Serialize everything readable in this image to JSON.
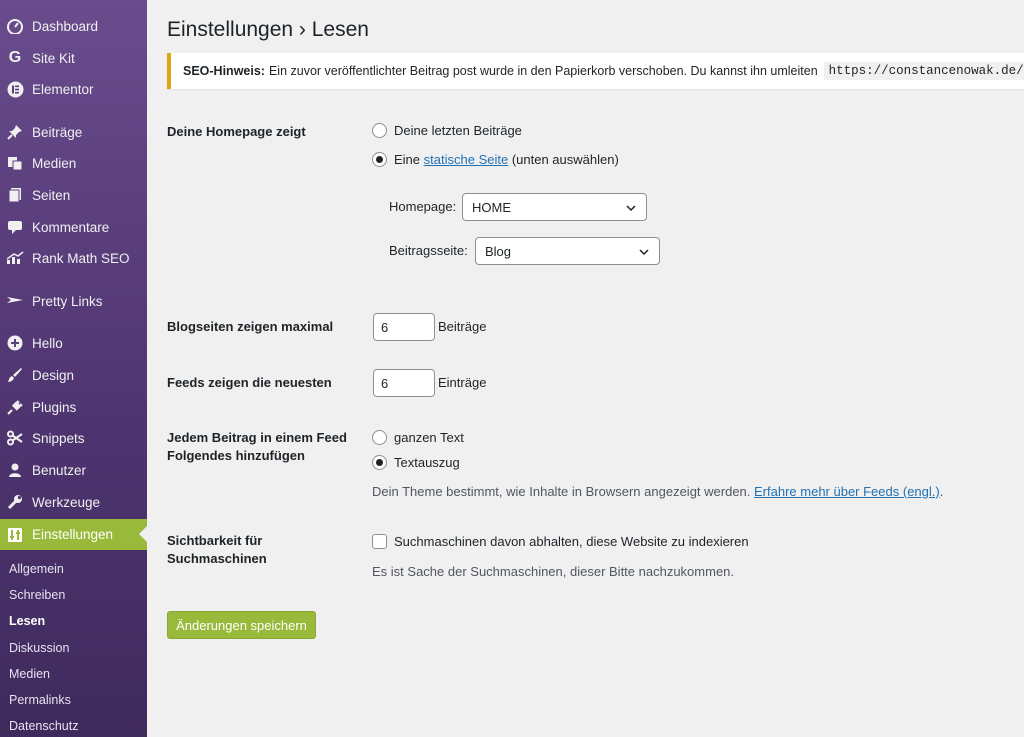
{
  "sidebar": {
    "items": [
      {
        "label": "Dashboard",
        "icon": "dashboard-icon"
      },
      {
        "label": "Site Kit",
        "icon": "google-g-icon"
      },
      {
        "label": "Elementor",
        "icon": "elementor-icon"
      },
      {
        "label": "Beiträge",
        "icon": "pin-icon"
      },
      {
        "label": "Medien",
        "icon": "media-icon"
      },
      {
        "label": "Seiten",
        "icon": "pages-icon"
      },
      {
        "label": "Kommentare",
        "icon": "comment-icon"
      },
      {
        "label": "Rank Math SEO",
        "icon": "rank-math-icon"
      },
      {
        "label": "Pretty Links",
        "icon": "pretty-links-icon"
      },
      {
        "label": "Hello",
        "icon": "plus-circle-icon"
      },
      {
        "label": "Design",
        "icon": "brush-icon"
      },
      {
        "label": "Plugins",
        "icon": "plug-icon"
      },
      {
        "label": "Snippets",
        "icon": "scissors-icon"
      },
      {
        "label": "Benutzer",
        "icon": "user-icon"
      },
      {
        "label": "Werkzeuge",
        "icon": "wrench-icon"
      },
      {
        "label": "Einstellungen",
        "icon": "settings-icon",
        "active": true
      }
    ],
    "submenu": [
      {
        "label": "Allgemein"
      },
      {
        "label": "Schreiben"
      },
      {
        "label": "Lesen",
        "current": true
      },
      {
        "label": "Diskussion"
      },
      {
        "label": "Medien"
      },
      {
        "label": "Permalinks"
      },
      {
        "label": "Datenschutz"
      }
    ]
  },
  "page": {
    "title": "Einstellungen › Lesen",
    "notice": {
      "bold": "SEO-Hinweis:",
      "text": "Ein zuvor veröffentlichter Beitrag post wurde in den Papierkorb verschoben. Du kannst ihn umleiten",
      "code": "https://constancenowak.de/"
    }
  },
  "settings": {
    "homepage": {
      "label": "Deine Homepage zeigt",
      "option_latest": "Deine letzten Beiträge",
      "option_static_prefix": "Eine",
      "option_static_link": "statische Seite",
      "option_static_suffix": "(unten auswählen)",
      "selected": "static",
      "homepage_label": "Homepage:",
      "homepage_value": "HOME",
      "postspage_label": "Beitragsseite:",
      "postspage_value": "Blog"
    },
    "blog_pages": {
      "label": "Blogseiten zeigen maximal",
      "value": "6",
      "unit": "Beiträge"
    },
    "feeds": {
      "label": "Feeds zeigen die neuesten",
      "value": "6",
      "unit": "Einträge"
    },
    "feed_content": {
      "label_line1": "Jedem Beitrag in einem Feed",
      "label_line2": "Folgendes hinzufügen",
      "option_full": "ganzen Text",
      "option_excerpt": "Textauszug",
      "selected": "excerpt",
      "desc_text": "Dein Theme bestimmt, wie Inhalte in Browsern angezeigt werden.",
      "desc_link": "Erfahre mehr über Feeds (engl.)",
      "desc_end": "."
    },
    "visibility": {
      "label_line1": "Sichtbarkeit für",
      "label_line2": "Suchmaschinen",
      "checkbox_label": "Suchmaschinen davon abhalten, diese Website zu indexieren",
      "checked": false,
      "desc": "Es ist Sache der Suchmaschinen, dieser Bitte nachzukommen."
    },
    "save_label": "Änderungen speichern"
  },
  "colors": {
    "accent": "#99b93a",
    "sidebar": "#5b3f7c",
    "link": "#2271b1",
    "notice_border": "#dba617"
  }
}
